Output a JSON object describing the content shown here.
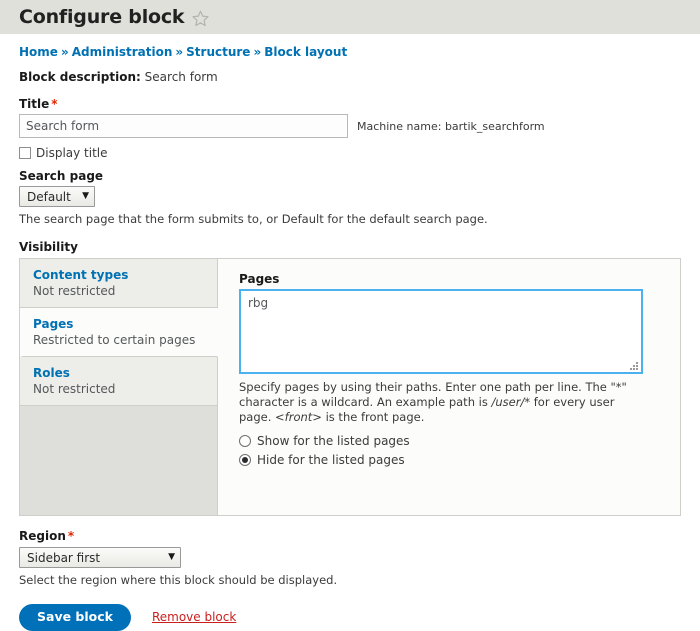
{
  "header": {
    "title": "Configure block",
    "favorite_icon": "star-outline-icon"
  },
  "breadcrumb": {
    "separator": "»",
    "items": [
      {
        "label": "Home"
      },
      {
        "label": "Administration"
      },
      {
        "label": "Structure"
      },
      {
        "label": "Block layout"
      }
    ]
  },
  "block_description": {
    "label": "Block description",
    "separator": ":",
    "value": "Search form"
  },
  "title_field": {
    "label": "Title",
    "required_marker": "*",
    "value": "Search form",
    "placeholder": "Search form",
    "machine_name": "Machine name: bartik_searchform"
  },
  "display_title": {
    "label": "Display title",
    "checked": false
  },
  "search_page": {
    "label": "Search page",
    "selected": "Default",
    "arrow": "▼",
    "help": "The search page that the form submits to, or Default for the default search page."
  },
  "visibility": {
    "label": "Visibility",
    "tabs": [
      {
        "title": "Content types",
        "subtitle": "Not restricted",
        "active": false
      },
      {
        "title": "Pages",
        "subtitle": "Restricted to certain pages",
        "active": true
      },
      {
        "title": "Roles",
        "subtitle": "Not restricted",
        "active": false
      }
    ],
    "pages_panel": {
      "label": "Pages",
      "textarea_value": "rbg",
      "help_part1": "Specify pages by using their paths. Enter one path per line. The \"*\" character is a wildcard. An example path is ",
      "help_em1": "/user/*",
      "help_part2": " for every user page. ",
      "help_em2": "<front>",
      "help_part3": " is the front page.",
      "options": [
        {
          "label": "Show for the listed pages",
          "selected": false
        },
        {
          "label": "Hide for the listed pages",
          "selected": true
        }
      ]
    }
  },
  "region": {
    "label": "Region",
    "required_marker": "*",
    "selected": "Sidebar first",
    "arrow": "▼",
    "help": "Select the region where this block should be displayed."
  },
  "actions": {
    "save_label": "Save block",
    "remove_label": "Remove block"
  }
}
